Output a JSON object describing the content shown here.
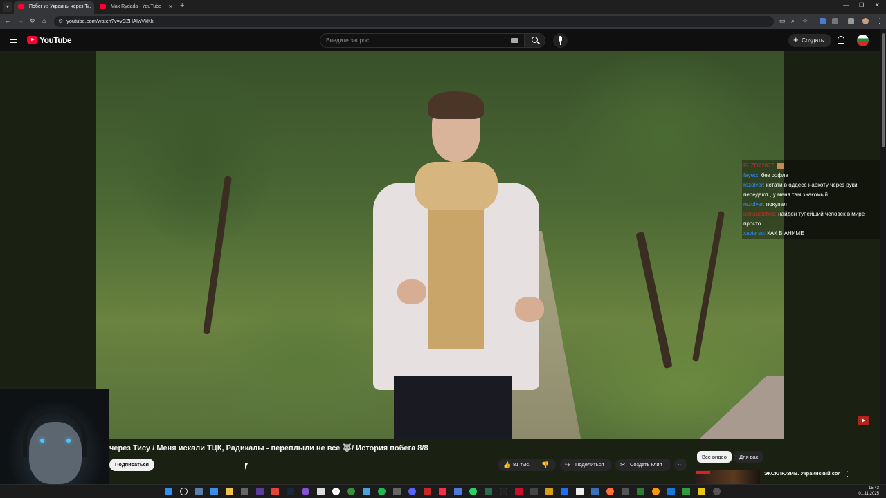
{
  "browser": {
    "tabs": [
      {
        "title": "Побег из Украины через Т...",
        "active": true
      },
      {
        "title": "Max Rydada - YouTube",
        "active": false
      }
    ],
    "url": "youtube.com/watch?v=vCZHAlwVkKk"
  },
  "youtube": {
    "logo_text": "YouTube",
    "search_placeholder": "Введите запрос",
    "create_label": "Создать"
  },
  "chat": [
    {
      "user": "FUZO22877:",
      "user_color": "red",
      "message": "",
      "emote": true
    },
    {
      "user": "fayetx:",
      "message": "без рофла"
    },
    {
      "user": "rezolver:",
      "message": "кстати в оддесе наркоту через руки передают , у меня там знакомый"
    },
    {
      "user": "rezolver:",
      "message": "покупал"
    },
    {
      "user": "ramsustafleo:",
      "user_color": "red",
      "message": "найден тупейший человек в мире просто"
    },
    {
      "user": "xavierso:",
      "message": "КАК В АНИМЕ"
    }
  ],
  "video": {
    "title": "через Тису / Меня искали ТЦК, Радикалы - переплыли не все 🐺/ История побега 8/8",
    "subscribe_label": "Подписаться",
    "likes": "81 тыс.",
    "share_label": "Поделиться",
    "clip_label": "Создать клип"
  },
  "sidebar": {
    "chips": [
      "Все видео",
      "Для вас"
    ],
    "next_video_title": "ЭКСКЛЮЗИВ. Украинский солдат рассказывает о..."
  },
  "taskbar": {
    "time": "15:43",
    "date": "01.11.2025"
  }
}
